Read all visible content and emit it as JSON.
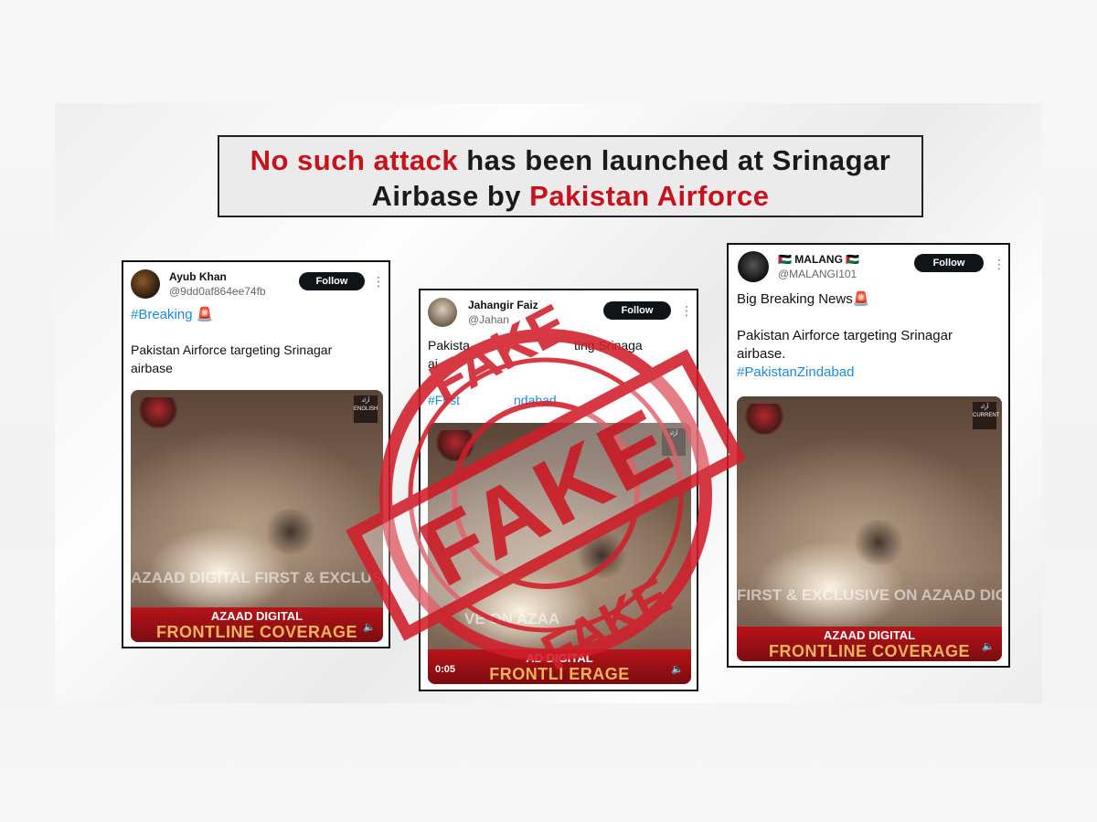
{
  "headline": {
    "part1_red": "No such attack",
    "part2": " has been launched at Srinagar Airbase by ",
    "part3_red": "Pakistan Airforce"
  },
  "follow_label": "Follow",
  "more_icon": "⋮",
  "posts": [
    {
      "name": "Ayub Khan",
      "handle": "@9dd0af864ee74fb",
      "hashtag": "#Breaking 🚨",
      "body": "Pakistan Airforce targeting Srinagar airbase",
      "video": {
        "brand_sub": "ENGLISH",
        "ticker": "AZAAD DIGITAL FIRST & EXCLUSIVE",
        "banner_line1": "AZAAD DIGITAL",
        "banner_line2": "FRONTLINE COVERAGE"
      }
    },
    {
      "name": "Jahangir Faiz",
      "handle": "@Jahan",
      "body_line1": "Pakista",
      "body_line2": "ting Srinaga",
      "body_line3": "ai",
      "hashtag": "#First",
      "hashtag2": "ndabad",
      "video": {
        "ticker": "VE ON AZAA",
        "time": "0:05",
        "banner_line1": "AD DIGITAL",
        "banner_line2": "FRONTLI      ERAGE"
      }
    },
    {
      "name": "🇵🇸 MALANG 🇵🇸",
      "handle": "@MALANGI101",
      "headline": "Big Breaking News🚨",
      "body": "Pakistan Airforce targeting Srinagar airbase.",
      "hashtag": "#PakistanZindabad",
      "video": {
        "brand_sub": "CURRENT",
        "ticker": "FIRST & EXCLUSIVE ON AZAAD DIG",
        "banner_line1": "AZAAD DIGITAL",
        "banner_line2": "FRONTLINE COVERAGE"
      }
    }
  ],
  "stamp_words": [
    "FAKE",
    "FAKE",
    "FAKE"
  ],
  "colors": {
    "stamp_red": "#d11e2a",
    "headline_red": "#c8121b",
    "hashtag_blue": "#1d8bd6"
  }
}
